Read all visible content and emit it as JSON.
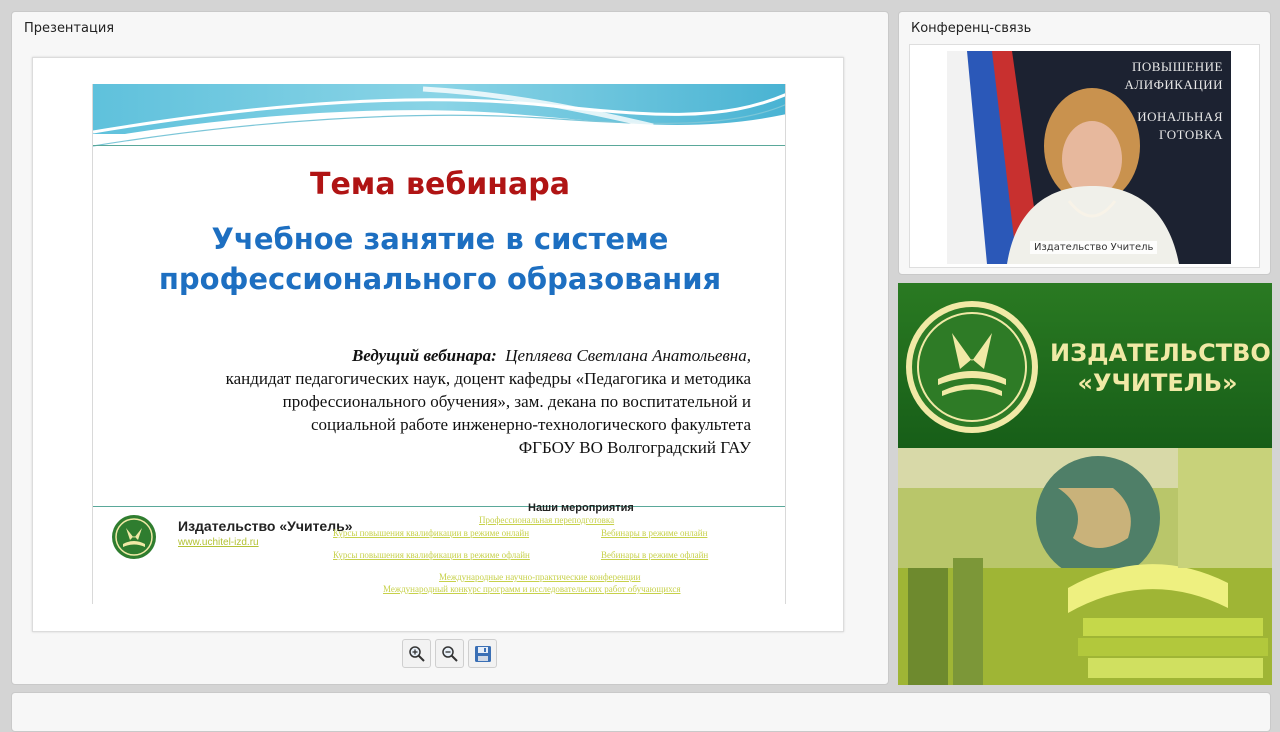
{
  "presentation": {
    "panel_title": "Презентация",
    "slide": {
      "topic": "Тема вебинара",
      "title": "Учебное занятие в системе профессионального образования",
      "host_label": "Ведущий вебинара:",
      "host_name": "Цепляева Светлана Анатольевна,",
      "host_lines": [
        "кандидат педагогических наук,  доцент кафедры «Педагогика и методика",
        "профессионального обучения», зам. декана по воспитательной и",
        "социальной работе инженерно-технологического факультета",
        "ФГБОУ ВО Волгоградский ГАУ"
      ],
      "footer_publisher": "Издательство «Учитель»",
      "footer_url": "www.uchitel-izd.ru",
      "events_title": "Наши мероприятия",
      "events": [
        "Профессиональная переподготовка",
        "Курсы повышения квалификации в режиме онлайн",
        "Вебинары в режиме онлайн",
        "Курсы повышения квалификации в режиме офлайн",
        "Вебинары в режиме офлайн",
        "Международные научно-практические конференции",
        "Международный конкурс программ и исследовательских работ обучающихся"
      ]
    },
    "toolbar": {
      "zoom_in_icon": "zoom-in-icon",
      "zoom_out_icon": "zoom-out-icon",
      "save_icon": "save-icon"
    }
  },
  "conference": {
    "panel_title": "Конференц-связь",
    "video_label": "Издательство Учитель",
    "background_text": [
      "ПОВЫШЕНИЕ",
      "АЛИФИКАЦИИ",
      "ИОНАЛЬНАЯ",
      "ГОТОВКА"
    ]
  },
  "banner": {
    "name_line1": "ИЗДАТЕЛЬСТВО",
    "name_line2": "«УЧИТЕЛЬ»"
  },
  "colors": {
    "topic_red": "#b01414",
    "title_blue": "#1d6fc1",
    "banner_green": "#1d6a1d",
    "banner_text": "#f1e9a6"
  }
}
